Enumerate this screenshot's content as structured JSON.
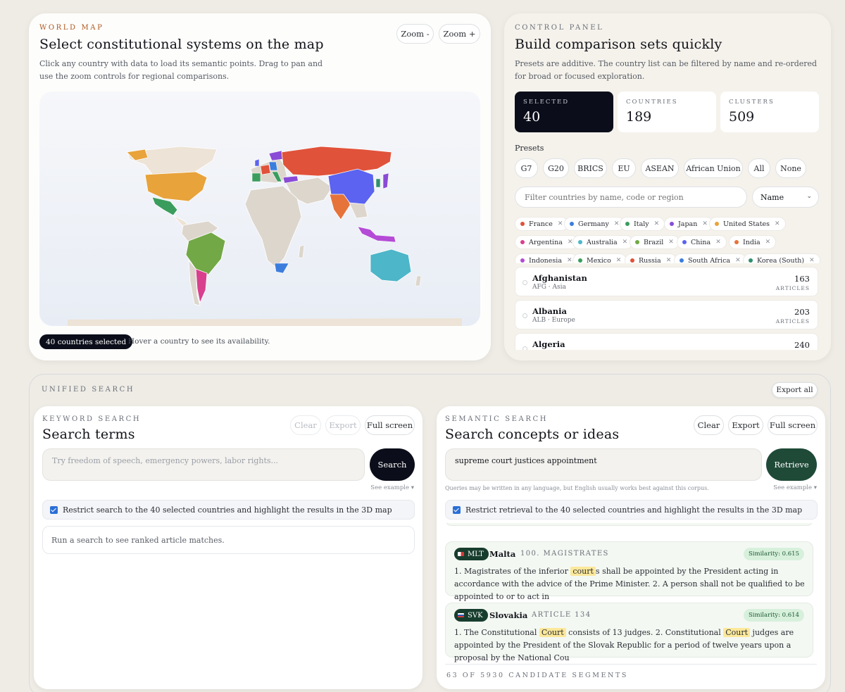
{
  "map": {
    "eyebrow": "WORLD MAP",
    "title": "Select constitutional systems on the map",
    "description": "Click any country with data to load its semantic points. Drag to pan and use the zoom controls for regional comparisons.",
    "zoom_out": "Zoom -",
    "zoom_in": "Zoom +",
    "selected_badge": "40 countries selected",
    "hover_hint": "Hover a country to see its availability."
  },
  "control": {
    "eyebrow": "CONTROL PANEL",
    "title": "Build comparison sets quickly",
    "description": "Presets are additive. The country list can be filtered by name and re-ordered for broad or focused exploration.",
    "stats": [
      {
        "label": "SELECTED",
        "value": "40"
      },
      {
        "label": "COUNTRIES",
        "value": "189"
      },
      {
        "label": "CLUSTERS",
        "value": "509"
      }
    ],
    "presets_label": "Presets",
    "presets": [
      "G7",
      "G20",
      "BRICS",
      "EU",
      "ASEAN",
      "African Union",
      "All",
      "None"
    ],
    "filter_placeholder": "Filter countries by name, code or region",
    "sort_value": "Name",
    "chips": [
      {
        "name": "France",
        "color": "#e0523a"
      },
      {
        "name": "Germany",
        "color": "#3b7ddd"
      },
      {
        "name": "Italy",
        "color": "#3a9d5d"
      },
      {
        "name": "Japan",
        "color": "#8a4bd6"
      },
      {
        "name": "United States",
        "color": "#e8a33b"
      },
      {
        "name": "Argentina",
        "color": "#d8408e"
      },
      {
        "name": "Australia",
        "color": "#4db6c9"
      },
      {
        "name": "Brazil",
        "color": "#72a845"
      },
      {
        "name": "China",
        "color": "#5b63f0"
      },
      {
        "name": "India",
        "color": "#e6733a"
      },
      {
        "name": "Indonesia",
        "color": "#b44bd6"
      },
      {
        "name": "Mexico",
        "color": "#3a9d5d"
      },
      {
        "name": "Russia",
        "color": "#e0523a"
      },
      {
        "name": "South Africa",
        "color": "#3b7ddd"
      },
      {
        "name": "Korea (South)",
        "color": "#2f8f6e"
      }
    ],
    "countries": [
      {
        "name": "Afghanistan",
        "sub": "AFG · Asia",
        "count": "163",
        "unit": "ARTICLES"
      },
      {
        "name": "Albania",
        "sub": "ALB · Europe",
        "count": "203",
        "unit": "ARTICLES"
      },
      {
        "name": "Algeria",
        "sub": "",
        "count": "240",
        "unit": ""
      }
    ]
  },
  "unified": {
    "eyebrow": "UNIFIED SEARCH",
    "export_all": "Export all"
  },
  "keyword": {
    "eyebrow": "KEYWORD SEARCH",
    "title": "Search terms",
    "clear": "Clear",
    "export": "Export",
    "fullscreen": "Full screen",
    "placeholder": "Try freedom of speech, emergency powers, labor rights...",
    "search_btn": "Search",
    "see_example": "See example ▾",
    "restrict": "Restrict search to the 40 selected countries and highlight the results in the 3D map",
    "empty": "Run a search to see ranked article matches."
  },
  "semantic": {
    "eyebrow": "SEMANTIC SEARCH",
    "title": "Search concepts or ideas",
    "clear": "Clear",
    "export": "Export",
    "fullscreen": "Full screen",
    "query": "supreme court justices appointment",
    "retrieve_btn": "Retrieve",
    "hint": "Queries may be written in any language, but English usually works best against this corpus.",
    "see_example": "See example ▾",
    "restrict": "Restrict retrieval to the 40 selected countries and highlight the results in the 3D map",
    "results": [
      {
        "code": "MLT",
        "country": "Malta",
        "article": "100. MAGISTRATES",
        "similarity": "Similarity: 0.615",
        "text_1": "1. Magistrates of the inferior ",
        "highlight": "court",
        "text_2": "s shall be appointed by the President acting in accordance with the advice of the Prime Minister. 2. A person shall not be qualified to be appointed to or to act in"
      },
      {
        "code": "SVK",
        "country": "Slovakia",
        "article": "ARTICLE 134",
        "similarity": "Similarity: 0.614",
        "text_1": "1. The Constitutional ",
        "highlight": "Court",
        "text_2": " consists of 13 judges. 2. Constitutional ",
        "highlight_2": "Court",
        "text_3": " judges are appointed by the President of the Slovak Republic for a period of twelve years upon a proposal by the National Cou"
      }
    ],
    "footer": "63 OF 5930 CANDIDATE SEGMENTS"
  }
}
